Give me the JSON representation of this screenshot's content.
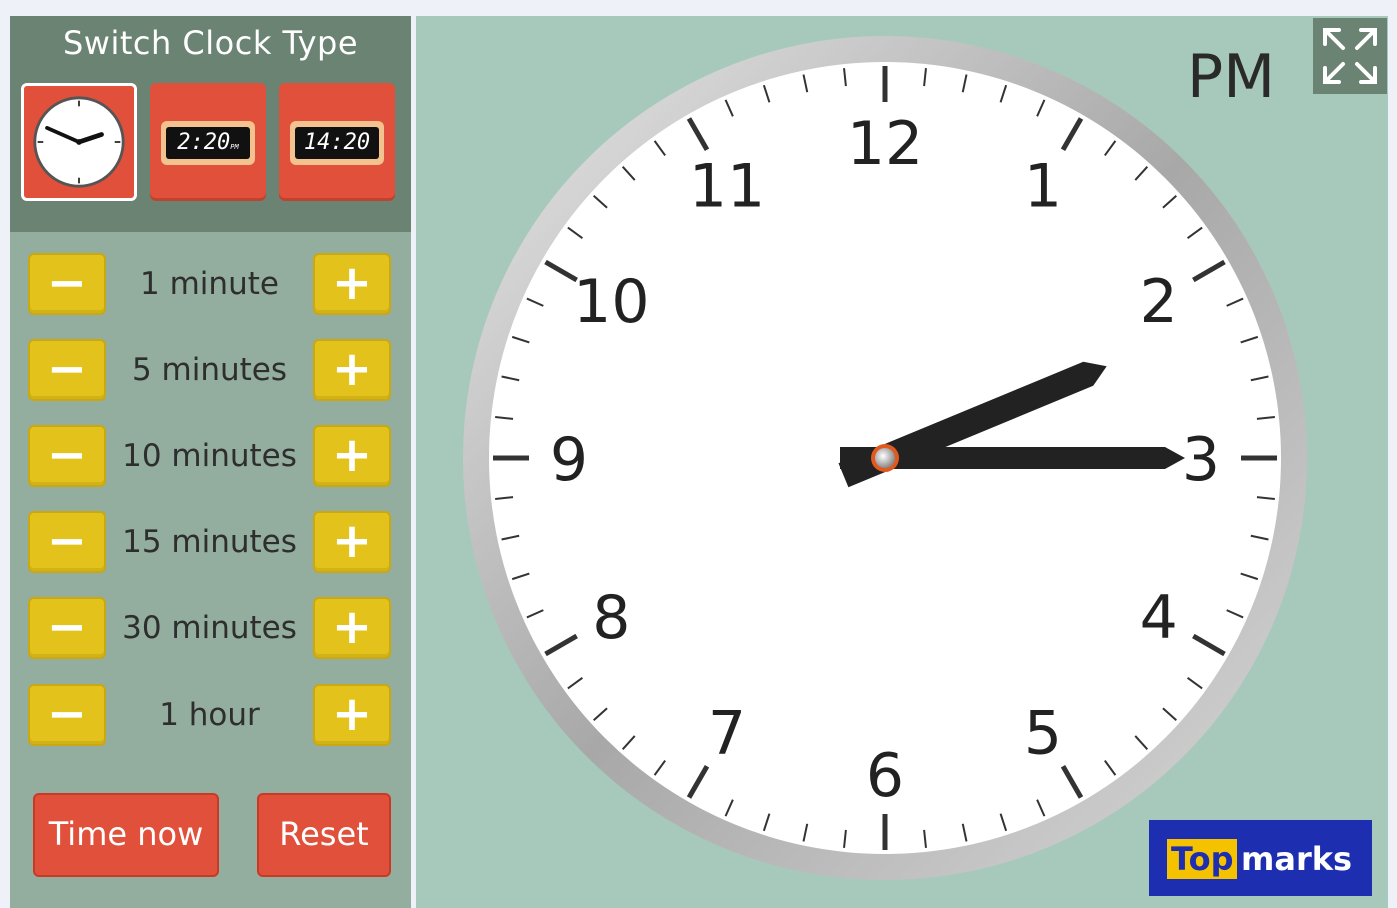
{
  "switch_panel": {
    "title": "Switch Clock Type",
    "digital_12h_display": "2:20",
    "digital_12h_suffix": "PM",
    "digital_24h_display": "14:20"
  },
  "steps": [
    {
      "minus": "−",
      "label": "1 minute",
      "plus": "+"
    },
    {
      "minus": "−",
      "label": "5 minutes",
      "plus": "+"
    },
    {
      "minus": "−",
      "label": "10 minutes",
      "plus": "+"
    },
    {
      "minus": "−",
      "label": "15 minutes",
      "plus": "+"
    },
    {
      "minus": "−",
      "label": "30 minutes",
      "plus": "+"
    },
    {
      "minus": "−",
      "label": "1 hour",
      "plus": "+"
    }
  ],
  "actions": {
    "time_now": "Time now",
    "reset": "Reset"
  },
  "clock": {
    "period": "PM",
    "hour": 2,
    "minute": 15,
    "numbers": [
      "12",
      "1",
      "2",
      "3",
      "4",
      "5",
      "6",
      "7",
      "8",
      "9",
      "10",
      "11"
    ],
    "hand_color": "#222222",
    "pivot_color": "#e05a20"
  },
  "logo": {
    "top": "Top",
    "marks": "marks"
  },
  "icons": {
    "fullscreen": "fullscreen-icon"
  },
  "colors": {
    "panel_green": "#93ad9e",
    "panel_dark": "#6b8372",
    "clock_bg": "#a7c9bc",
    "button_red": "#e0503a",
    "button_yellow": "#e3c31b",
    "logo_blue": "#1d2fb0",
    "logo_yellow": "#f5c200"
  }
}
